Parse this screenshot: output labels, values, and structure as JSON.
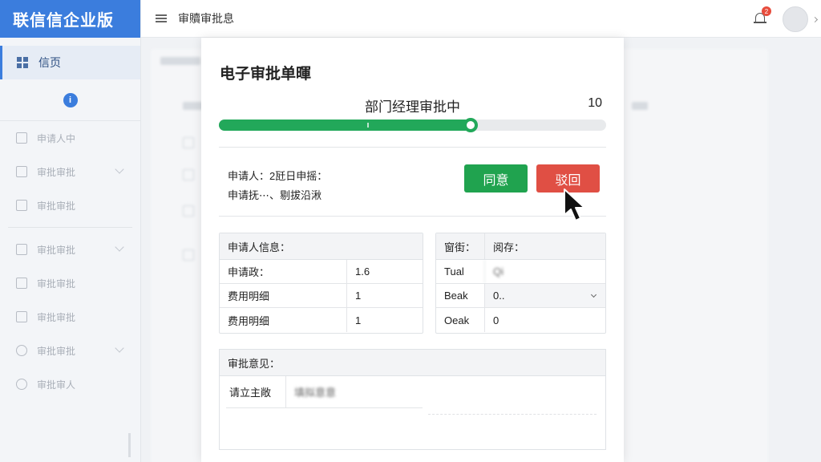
{
  "app": {
    "brand": "联信信企业版"
  },
  "topbar": {
    "title": "审贖审批息",
    "notification_count": "2"
  },
  "sidebar": {
    "items": [
      {
        "label": "信页",
        "active": true,
        "icon": "grid-icon"
      },
      {
        "label": "申请人中",
        "icon": "apps-icon"
      },
      {
        "label": "审批审批",
        "icon": "calendar-icon",
        "expandable": true
      },
      {
        "label": "审批审批",
        "icon": "document-icon"
      },
      {
        "label": "审批审批",
        "icon": "edit-icon",
        "expandable": true
      },
      {
        "label": "审批审批",
        "icon": "square-icon"
      },
      {
        "label": "审批审批",
        "icon": "square-icon"
      },
      {
        "label": "审批审批",
        "icon": "clock-icon",
        "expandable": true
      },
      {
        "label": "审批审人",
        "icon": "user-icon"
      }
    ]
  },
  "modal": {
    "title": "电子审批单暉",
    "stage_label": "部门经理审批中",
    "step_count": "10",
    "progress_fraction": 0.65,
    "applicant_line1": "申请人：2瓩日申摇：",
    "applicant_line2": "申请抚⋯、剔拔沿湫",
    "agree_label": "同意",
    "reject_label": "驳回",
    "info_table": {
      "header": "申请人信息：",
      "rows": [
        {
          "label": "申请政：",
          "value": "1.6"
        },
        {
          "label": "费用明细",
          "value": "1"
        },
        {
          "label": "费用明细",
          "value": "1"
        }
      ]
    },
    "side_table": {
      "header_left": "窗街：",
      "header_right": "阅存：",
      "rows": [
        {
          "label": "Tual",
          "value": "Qi"
        },
        {
          "label": "Beak",
          "value": "0..",
          "select": true
        },
        {
          "label": "Oeak",
          "value": "0"
        }
      ]
    },
    "opinion": {
      "header": "审批意见：",
      "label": "请立主敞",
      "placeholder": "填拟意意"
    }
  },
  "colors": {
    "brand": "#3b7ddd",
    "agree": "#20a34f",
    "reject": "#e04f44",
    "progress": "#22a85a"
  }
}
